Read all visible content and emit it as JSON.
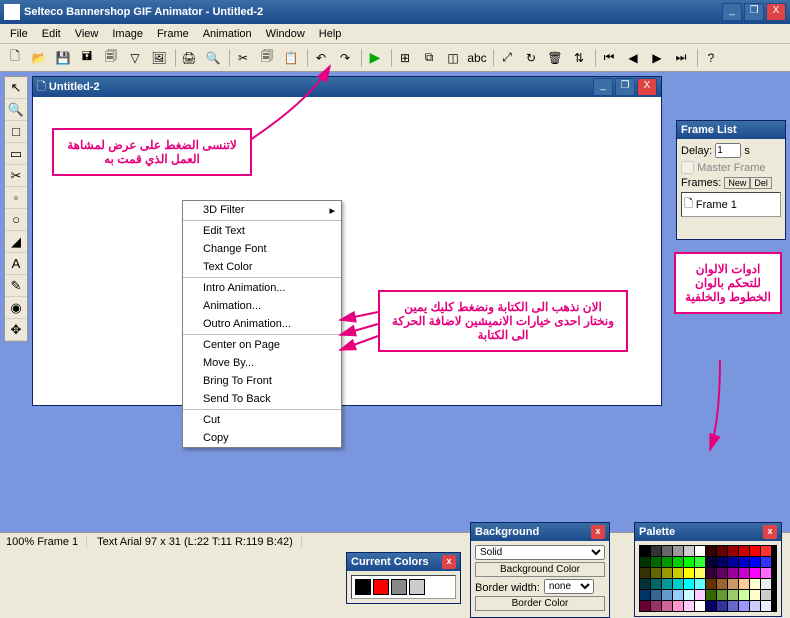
{
  "window": {
    "title": "Selteco Bannershop GIF Animator - Untitled-2",
    "minimize": "_",
    "restore": "❐",
    "close": "X"
  },
  "menu": [
    "File",
    "Edit",
    "View",
    "Image",
    "Frame",
    "Animation",
    "Window",
    "Help"
  ],
  "document": {
    "title": "Untitled-2",
    "minimize": "_",
    "restore": "❐",
    "close": "X"
  },
  "tools": [
    "↖",
    "🔍",
    "□",
    "▭",
    "✂",
    "◦",
    "○",
    "◢",
    "A",
    "✎",
    "◉",
    "✥"
  ],
  "contextmenu": {
    "items": [
      {
        "label": "3D Filter",
        "arrow": true
      },
      "-",
      {
        "label": "Edit Text"
      },
      {
        "label": "Change Font"
      },
      {
        "label": "Text Color"
      },
      "-",
      {
        "label": "Intro Animation..."
      },
      {
        "label": "Animation..."
      },
      {
        "label": "Outro Animation..."
      },
      "-",
      {
        "label": "Center on Page"
      },
      {
        "label": "Move By..."
      },
      {
        "label": "Bring To Front"
      },
      {
        "label": "Send To Back"
      },
      "-",
      {
        "label": "Cut"
      },
      {
        "label": "Copy"
      }
    ]
  },
  "callouts": {
    "c1": "لاتنسى الضغط على عرض لمشاهة العمل الذي قمت به",
    "c2": "الان نذهب الى الكتابة ونضغط كليك يمين ونختار احدى خيارات الانميشين لاضافة الحركة الى الكتابة",
    "c3": "ادوات الالوان للتحكم بالوان الخطوط والخلفية"
  },
  "framelist": {
    "title": "Frame List",
    "delay_label": "Delay:",
    "delay_value": "1",
    "delay_unit": "s",
    "master": "Master Frame",
    "frames_label": "Frames:",
    "new_btn": "New",
    "del_btn": "Del",
    "frame1": "Frame 1"
  },
  "currentcolors": {
    "title": "Current Colors",
    "close": "x",
    "colors": [
      "#000000",
      "#ff0000",
      "#888888",
      "#cccccc"
    ]
  },
  "background": {
    "title": "Background",
    "close": "x",
    "type": "Solid",
    "bgcolor_btn": "Background Color",
    "borderw_label": "Border width:",
    "borderw_value": "none",
    "bordercolor_btn": "Border Color"
  },
  "palette": {
    "title": "Palette",
    "close": "x",
    "colors": [
      "#000",
      "#333",
      "#666",
      "#999",
      "#ccc",
      "#fff",
      "#300",
      "#600",
      "#900",
      "#c00",
      "#f00",
      "#f33",
      "#030",
      "#060",
      "#090",
      "#0c0",
      "#0f0",
      "#3f3",
      "#003",
      "#006",
      "#009",
      "#00c",
      "#00f",
      "#33f",
      "#330",
      "#660",
      "#990",
      "#cc0",
      "#ff0",
      "#ff6",
      "#303",
      "#606",
      "#909",
      "#c0c",
      "#f0f",
      "#f6f",
      "#033",
      "#066",
      "#099",
      "#0cc",
      "#0ff",
      "#6ff",
      "#630",
      "#963",
      "#c96",
      "#fc9",
      "#ffc",
      "#eee",
      "#036",
      "#369",
      "#69c",
      "#9cf",
      "#cff",
      "#fcf",
      "#360",
      "#693",
      "#9c6",
      "#cf9",
      "#ffc",
      "#ccc",
      "#603",
      "#936",
      "#c69",
      "#f9c",
      "#fcf",
      "#fff",
      "#006",
      "#339",
      "#66c",
      "#99f",
      "#ccf",
      "#eef"
    ]
  },
  "status": {
    "s1": "100% Frame 1",
    "s2": "Text Arial 97 x 31 (L:22 T:11 R:119 B:42)"
  }
}
